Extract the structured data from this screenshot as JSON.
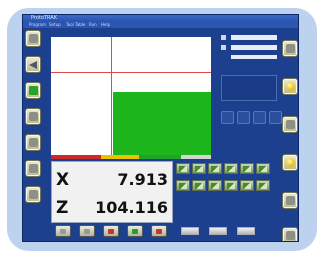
{
  "window": {
    "title": "ProtoTRAK"
  },
  "menu": [
    "Program",
    "Setup",
    "Tool Table",
    "Run",
    "Help"
  ],
  "dro": {
    "x_label": "X",
    "x_value": "7.913",
    "z_label": "Z",
    "z_value": "104.116"
  },
  "colors": {
    "progress_red": "#cc2a2a",
    "progress_yellow": "#e8c400",
    "progress_green": "#22a22a"
  },
  "left_buttons": [
    "grey-icon",
    "back-arrow-icon",
    "green-icon",
    "grey-icon",
    "grey-icon",
    "grey-icon",
    "grey-icon"
  ],
  "right_buttons": [
    "grey-icon",
    "yellow-light-icon",
    "grey-icon",
    "yellow-light-icon",
    "grey-icon",
    "grey-icon"
  ]
}
